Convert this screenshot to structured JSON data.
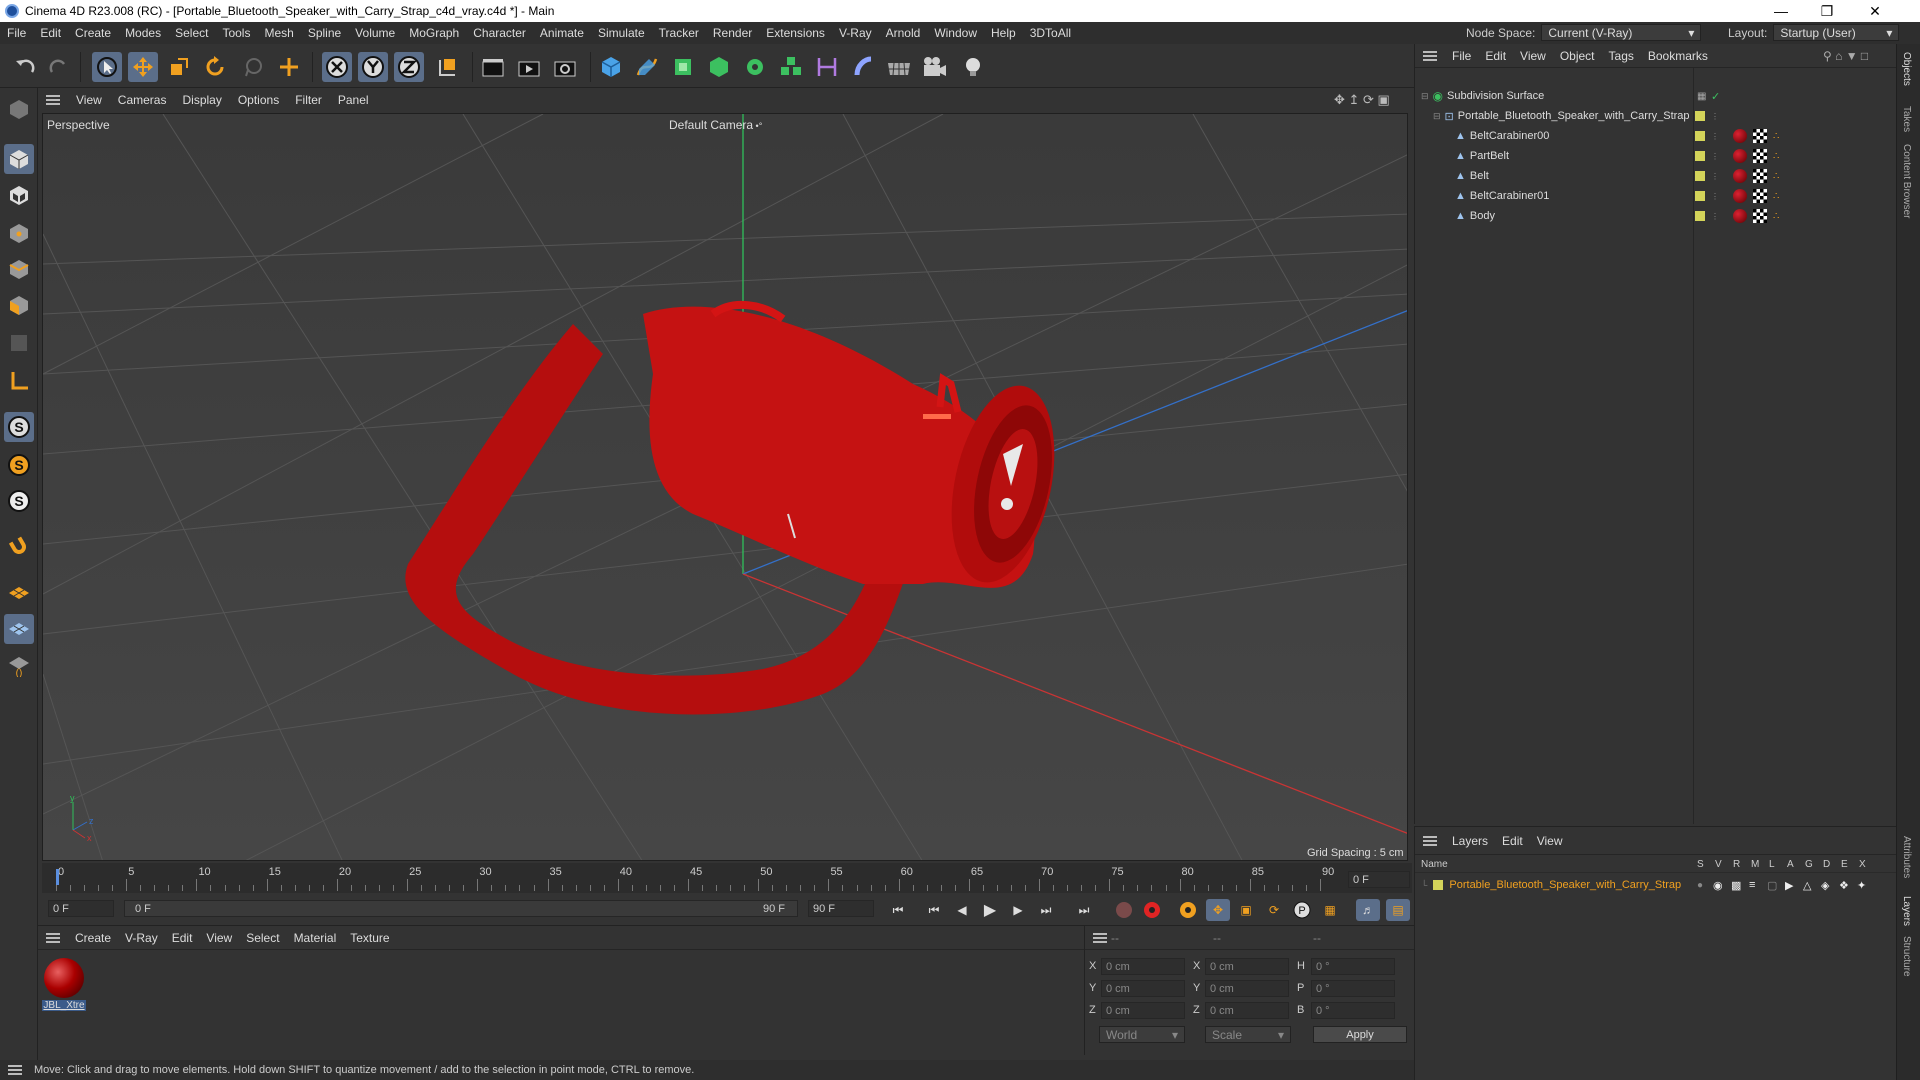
{
  "titlebar": {
    "title": "Cinema 4D R23.008 (RC) - [Portable_Bluetooth_Speaker_with_Carry_Strap_c4d_vray.c4d *] - Main"
  },
  "menubar": {
    "items": [
      "File",
      "Edit",
      "Create",
      "Modes",
      "Select",
      "Tools",
      "Mesh",
      "Spline",
      "Volume",
      "MoGraph",
      "Character",
      "Animate",
      "Simulate",
      "Tracker",
      "Render",
      "Extensions",
      "V-Ray",
      "Arnold",
      "Window",
      "Help",
      "3DToAll"
    ]
  },
  "nodespace": {
    "label": "Node Space:",
    "value": "Current (V-Ray)"
  },
  "layout": {
    "label": "Layout:",
    "value": "Startup (User)"
  },
  "viewport": {
    "menu": [
      "View",
      "Cameras",
      "Display",
      "Options",
      "Filter",
      "Panel"
    ],
    "projection": "Perspective",
    "camera": "Default Camera",
    "grid_spacing": "Grid Spacing : 5 cm"
  },
  "timeline": {
    "ticks": [
      "0",
      "5",
      "10",
      "15",
      "20",
      "25",
      "30",
      "35",
      "40",
      "45",
      "50",
      "55",
      "60",
      "65",
      "70",
      "75",
      "80",
      "85",
      "90"
    ],
    "current_frame": "0 F"
  },
  "playbar": {
    "start": "0 F",
    "range_start": "0 F",
    "range_end": "90 F",
    "end": "90 F"
  },
  "material_panel": {
    "menu": [
      "Create",
      "V-Ray",
      "Edit",
      "View",
      "Select",
      "Material",
      "Texture"
    ],
    "materials": [
      {
        "name": "JBL_Xtre"
      }
    ]
  },
  "coords": {
    "headers": [
      "--",
      "--",
      "--"
    ],
    "rows": [
      {
        "a": "X",
        "av": "0 cm",
        "b": "X",
        "bv": "0 cm",
        "c": "H",
        "cv": "0 °"
      },
      {
        "a": "Y",
        "av": "0 cm",
        "b": "Y",
        "bv": "0 cm",
        "c": "P",
        "cv": "0 °"
      },
      {
        "a": "Z",
        "av": "0 cm",
        "b": "Z",
        "bv": "0 cm",
        "c": "B",
        "cv": "0 °"
      }
    ],
    "mode1": "World",
    "mode2": "Scale",
    "apply": "Apply"
  },
  "status": {
    "text": "Move: Click and drag to move elements. Hold down SHIFT to quantize movement / add to the selection in point mode, CTRL to remove."
  },
  "object_manager": {
    "menu": [
      "File",
      "Edit",
      "View",
      "Object",
      "Tags",
      "Bookmarks"
    ],
    "objects": [
      {
        "name": "Subdivision Surface"
      },
      {
        "name": "Portable_Bluetooth_Speaker_with_Carry_Strap"
      },
      {
        "name": "BeltCarabiner00"
      },
      {
        "name": "PartBelt"
      },
      {
        "name": "Belt"
      },
      {
        "name": "BeltCarabiner01"
      },
      {
        "name": "Body"
      }
    ]
  },
  "layer_manager": {
    "menu": [
      "Layers",
      "Edit",
      "View"
    ],
    "columns": [
      "Name",
      "S",
      "V",
      "R",
      "M",
      "L",
      "A",
      "G",
      "D",
      "E",
      "X"
    ],
    "layers": [
      {
        "name": "Portable_Bluetooth_Speaker_with_Carry_Strap"
      }
    ]
  },
  "side_tabs": [
    "Objects",
    "Takes",
    "Content Browser",
    "Attributes",
    "Layers",
    "Structure"
  ]
}
